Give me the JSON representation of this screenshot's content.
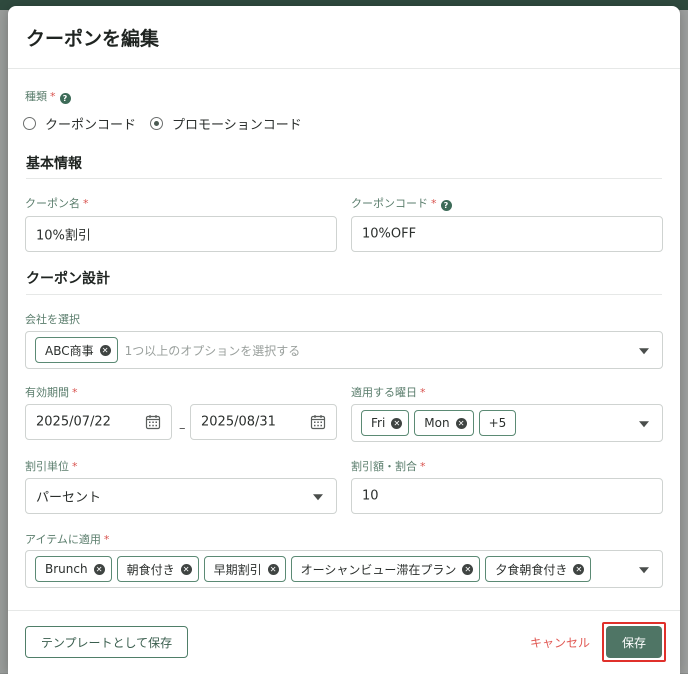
{
  "modal": {
    "title": "クーポンを編集"
  },
  "type_field": {
    "label": "種類",
    "required_mark": "*",
    "help_glyph": "?",
    "options": [
      {
        "label": "クーポンコード",
        "checked": false
      },
      {
        "label": "プロモーションコード",
        "checked": true
      }
    ]
  },
  "basic_info": {
    "title": "基本情報",
    "coupon_name": {
      "label": "クーポン名",
      "required_mark": "*",
      "value": "10%割引"
    },
    "coupon_code": {
      "label": "クーポンコード",
      "required_mark": "*",
      "help_glyph": "?",
      "value": "10%OFF"
    }
  },
  "design": {
    "title": "クーポン設計",
    "company": {
      "label": "会社を選択",
      "chips": [
        "ABC商事"
      ],
      "placeholder": "1つ以上のオプションを選択する"
    },
    "validity": {
      "label": "有効期間",
      "required_mark": "*",
      "start": "2025/07/22",
      "separator": "–",
      "end": "2025/08/31"
    },
    "weekdays": {
      "label": "適用する曜日",
      "required_mark": "*",
      "chips": [
        "Fri",
        "Mon"
      ],
      "more": "+5"
    },
    "discount_unit": {
      "label": "割引単位",
      "required_mark": "*",
      "value": "パーセント"
    },
    "discount_amount": {
      "label": "割引額・割合",
      "required_mark": "*",
      "value": "10"
    },
    "items": {
      "label": "アイテムに適用",
      "required_mark": "*",
      "chips": [
        "Brunch",
        "朝食付き",
        "早期割引",
        "オーシャンビュー滞在プラン",
        "夕食朝食付き"
      ]
    }
  },
  "footer": {
    "template_button": "テンプレートとして保存",
    "cancel_button": "キャンセル",
    "save_button": "保存"
  },
  "colors": {
    "accent": "#4f7565",
    "cancel": "#e15a55",
    "highlight": "#e0302b"
  }
}
